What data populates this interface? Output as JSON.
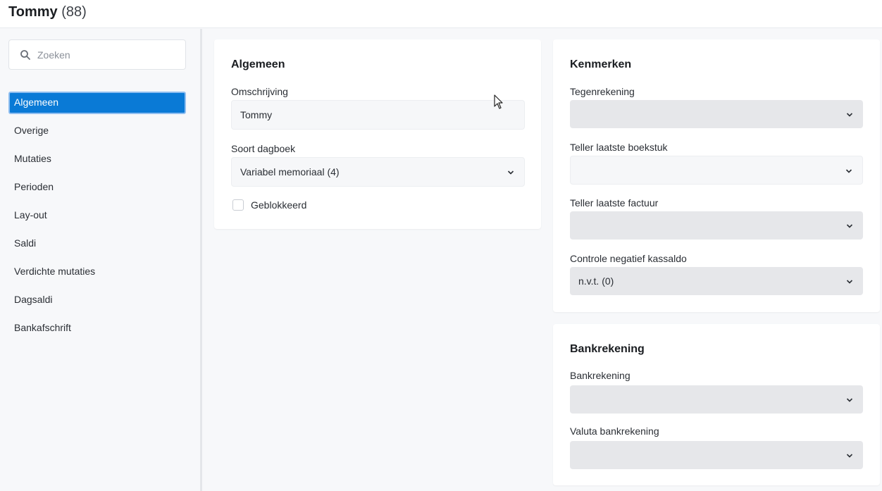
{
  "header": {
    "name": "Tommy",
    "count": "(88)"
  },
  "sidebar": {
    "search_placeholder": "Zoeken",
    "items": [
      {
        "label": "Algemeen",
        "active": true
      },
      {
        "label": "Overige"
      },
      {
        "label": "Mutaties"
      },
      {
        "label": "Perioden"
      },
      {
        "label": "Lay-out"
      },
      {
        "label": "Saldi"
      },
      {
        "label": "Verdichte mutaties"
      },
      {
        "label": "Dagsaldi"
      },
      {
        "label": "Bankafschrift"
      }
    ]
  },
  "algemeen": {
    "title": "Algemeen",
    "omschrijving_label": "Omschrijving",
    "omschrijving_value": "Tommy",
    "soort_label": "Soort dagboek",
    "soort_value": "Variabel memoriaal (4)",
    "geblokkeerd_label": "Geblokkeerd"
  },
  "kenmerken": {
    "title": "Kenmerken",
    "tegenrekening_label": "Tegenrekening",
    "tegenrekening_value": "",
    "boekstuk_label": "Teller laatste boekstuk",
    "boekstuk_value": "",
    "factuur_label": "Teller laatste factuur",
    "factuur_value": "",
    "kassaldo_label": "Controle negatief kassaldo",
    "kassaldo_value": "n.v.t. (0)"
  },
  "bankrekening": {
    "title": "Bankrekening",
    "bankrekening_label": "Bankrekening",
    "bankrekening_value": "",
    "valuta_label": "Valuta bankrekening",
    "valuta_value": ""
  },
  "colors": {
    "accent": "#0a7ad6",
    "background": "#f7f8fa",
    "select_bg": "#e6e7ea"
  }
}
